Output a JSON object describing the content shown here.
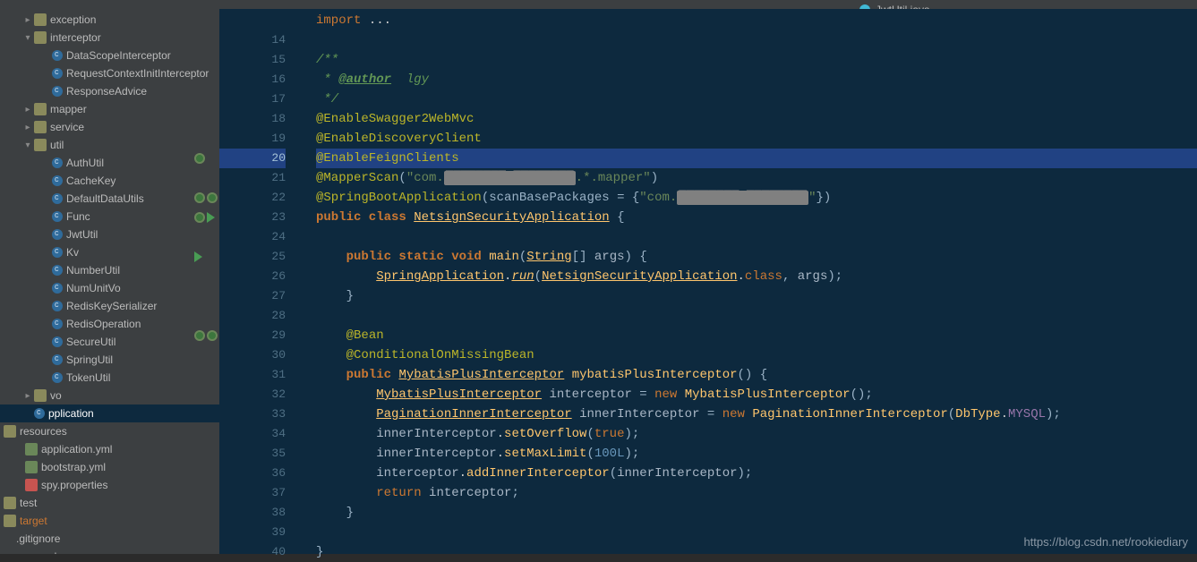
{
  "open_tab": {
    "filename": "JwtUtil.java",
    "icon": "java-class-icon"
  },
  "watermark": "https://blog.csdn.net/rookiediary",
  "sidebar": {
    "tree": [
      {
        "depth": 1,
        "arrow": "right",
        "icon": "dir",
        "label": "exception"
      },
      {
        "depth": 1,
        "arrow": "down",
        "icon": "dir",
        "label": "interceptor"
      },
      {
        "depth": 2,
        "arrow": "",
        "icon": "class",
        "label": "DataScopeInterceptor"
      },
      {
        "depth": 2,
        "arrow": "",
        "icon": "class",
        "label": "RequestContextInitInterceptor"
      },
      {
        "depth": 2,
        "arrow": "",
        "icon": "class",
        "label": "ResponseAdvice"
      },
      {
        "depth": 1,
        "arrow": "right",
        "icon": "dir",
        "label": "mapper"
      },
      {
        "depth": 1,
        "arrow": "right",
        "icon": "dir",
        "label": "service"
      },
      {
        "depth": 1,
        "arrow": "down",
        "icon": "dir",
        "label": "util"
      },
      {
        "depth": 2,
        "arrow": "",
        "icon": "class",
        "label": "AuthUtil"
      },
      {
        "depth": 2,
        "arrow": "",
        "icon": "class",
        "label": "CacheKey"
      },
      {
        "depth": 2,
        "arrow": "",
        "icon": "class",
        "label": "DefaultDataUtils"
      },
      {
        "depth": 2,
        "arrow": "",
        "icon": "class",
        "label": "Func"
      },
      {
        "depth": 2,
        "arrow": "",
        "icon": "class",
        "label": "JwtUtil"
      },
      {
        "depth": 2,
        "arrow": "",
        "icon": "class",
        "label": "Kv"
      },
      {
        "depth": 2,
        "arrow": "",
        "icon": "class",
        "label": "NumberUtil"
      },
      {
        "depth": 2,
        "arrow": "",
        "icon": "class",
        "label": "NumUnitVo"
      },
      {
        "depth": 2,
        "arrow": "",
        "icon": "class",
        "label": "RedisKeySerializer"
      },
      {
        "depth": 2,
        "arrow": "",
        "icon": "class",
        "label": "RedisOperation"
      },
      {
        "depth": 2,
        "arrow": "",
        "icon": "class",
        "label": "SecureUtil"
      },
      {
        "depth": 2,
        "arrow": "",
        "icon": "class",
        "label": "SpringUtil"
      },
      {
        "depth": 2,
        "arrow": "",
        "icon": "class",
        "label": "TokenUtil"
      },
      {
        "depth": 1,
        "arrow": "right",
        "icon": "dir",
        "label": "vo"
      },
      {
        "depth": 1,
        "arrow": "",
        "icon": "class",
        "label": "                          pplication",
        "selected": true
      }
    ],
    "root_files": [
      {
        "icon": "dir",
        "label": "resources",
        "depth": 0
      },
      {
        "icon": "yml",
        "label": "application.yml",
        "depth": 1
      },
      {
        "icon": "yml",
        "label": "bootstrap.yml",
        "depth": 1
      },
      {
        "icon": "prop",
        "label": "spy.properties",
        "depth": 1
      },
      {
        "icon": "dir",
        "label": "test",
        "depth": 0
      },
      {
        "icon": "dir",
        "label": "target",
        "depth": 0,
        "target": true
      },
      {
        "icon": "",
        "label": ".gitignore",
        "depth": 0
      },
      {
        "icon": "",
        "label": "pom.xml",
        "depth": 0
      }
    ]
  },
  "editor": {
    "active_line": 20,
    "gutter": {
      "start": 14,
      "end": 40,
      "topLabel": "import ...",
      "icons": {
        "20": [
          "spring"
        ],
        "22": [
          "spring",
          "spring2"
        ],
        "23": [
          "spring",
          "run"
        ],
        "25": [
          "run"
        ],
        "29": [
          "spring",
          "spring2"
        ]
      }
    },
    "lines": {
      "13": {
        "html": "<span class='kw'>import</span> <span class='dot'>...</span>"
      },
      "14": {
        "html": ""
      },
      "15": {
        "html": "<span class='doc'>/**</span>"
      },
      "16": {
        "html": "<span class='doc'> * </span><span class='doctag'>@author</span><span class='doc'>  lgy</span>"
      },
      "17": {
        "html": "<span class='doc'> */</span>"
      },
      "18": {
        "html": "<span class='ann'>@EnableSwagger2WebMvc</span>"
      },
      "19": {
        "html": "<span class='ann'>@EnableDiscoveryClient</span>"
      },
      "20": {
        "html": "<span class='ann'>@EnableFeignClients</span>"
      },
      "21": {
        "html": "<span class='ann'>@MapperScan</span>(<span class='str'>\"com.<span class='redact'>████████ ████████</span>.*.mapper\"</span>)"
      },
      "22": {
        "html": "<span class='ann'>@SpringBootApplication</span>(scanBasePackages = {<span class='str'>\"com.<span class='redact'>████████ ████████</span>\"</span>})"
      },
      "23": {
        "html": "<span class='kwb'>public class</span> <span class='clsu'>NetsignSecurityApplication</span> {"
      },
      "24": {
        "html": ""
      },
      "25": {
        "html": "    <span class='kwb'>public static void</span> <span class='cls'>main</span>(<span class='clsu'>String</span>[] <span class='param'>args</span>) {"
      },
      "26": {
        "html": "        <span class='clsu'>SpringApplication</span><span class='dot'>.</span><span class='methodu'>run</span>(<span class='clsu'>NetsignSecurityApplication</span><span class='dot'>.</span><span class='kw'>class</span>, <span class='param'>args</span>);"
      },
      "27": {
        "html": "    }"
      },
      "28": {
        "html": ""
      },
      "29": {
        "html": "    <span class='ann'>@Bean</span>"
      },
      "30": {
        "html": "    <span class='ann'>@ConditionalOnMissingBean</span>"
      },
      "31": {
        "html": "    <span class='kwb'>public</span> <span class='clsu'>MybatisPlusInterceptor</span> <span class='cls'>mybatisPlusInterceptor</span>() {"
      },
      "32": {
        "html": "        <span class='clsu'>MybatisPlusInterceptor</span> <span class='param'>interceptor</span> = <span class='kw'>new</span> <span class='cls'>MybatisPlusInterceptor</span>();"
      },
      "33": {
        "html": "        <span class='clsu'>PaginationInnerInterceptor</span> <span class='param'>innerInterceptor</span> = <span class='kw'>new</span> <span class='cls'>PaginationInnerInterceptor</span>(<span class='cls'>DbType</span><span class='dot'>.</span><span class='field'>MYSQL</span>);"
      },
      "34": {
        "html": "        <span class='param'>innerInterceptor</span><span class='dot'>.</span><span class='cls'>setOverflow</span>(<span class='kw'>true</span>);"
      },
      "35": {
        "html": "        <span class='param'>innerInterceptor</span><span class='dot'>.</span><span class='cls'>setMaxLimit</span>(<span class='num'>100L</span>);"
      },
      "36": {
        "html": "        <span class='param'>interceptor</span><span class='dot'>.</span><span class='cls'>addInnerInterceptor</span>(<span class='param'>innerInterceptor</span>);"
      },
      "37": {
        "html": "        <span class='kw'>return</span> <span class='param'>interceptor</span>;"
      },
      "38": {
        "html": "    }"
      },
      "39": {
        "html": ""
      },
      "40": {
        "html": "}"
      }
    }
  }
}
